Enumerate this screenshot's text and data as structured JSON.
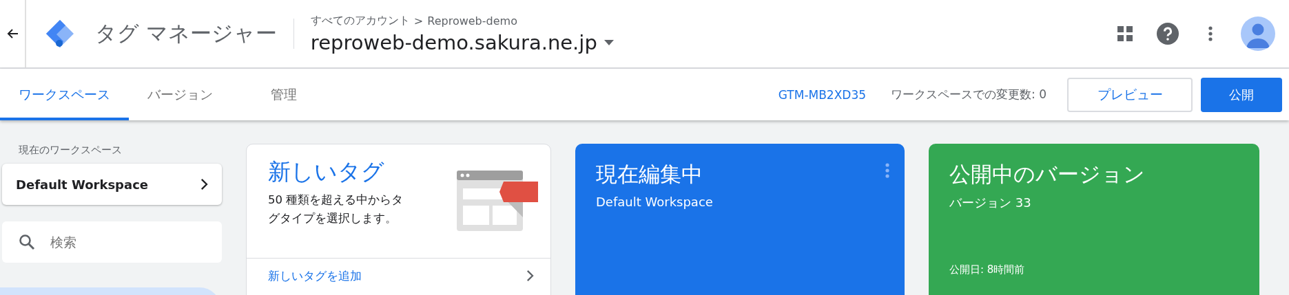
{
  "header": {
    "app_title": "タグ マネージャー",
    "breadcrumb": {
      "root": "すべてのアカウント",
      "separator": ">",
      "account": "Reproweb-demo"
    },
    "container_name": "reproweb-demo.sakura.ne.jp"
  },
  "tabs": [
    {
      "label": "ワークスペース",
      "selected": true
    },
    {
      "label": "バージョン",
      "selected": false
    },
    {
      "label": "管理",
      "selected": false
    }
  ],
  "toolbar": {
    "container_id": "GTM-MB2XD35",
    "changes": "ワークスペースでの変更数: 0",
    "preview_button": "プレビュー",
    "publish_button": "公開"
  },
  "sidebar": {
    "workspace_label": "現在のワークスペース",
    "workspace": "Default Workspace",
    "search": {
      "placeholder": "検索"
    }
  },
  "cards": [
    {
      "kind": "new_tag",
      "title": "新しいタグ",
      "description": "50 種類を超える中からタグタイプを選択します。",
      "link": "新しいタグを追加"
    },
    {
      "kind": "editing",
      "title": "現在編集中",
      "subtitle": "Default Workspace"
    },
    {
      "kind": "published",
      "title": "公開中のバージョン",
      "subtitle": "バージョン 33",
      "footer": "公開日: 8時間前"
    }
  ]
}
